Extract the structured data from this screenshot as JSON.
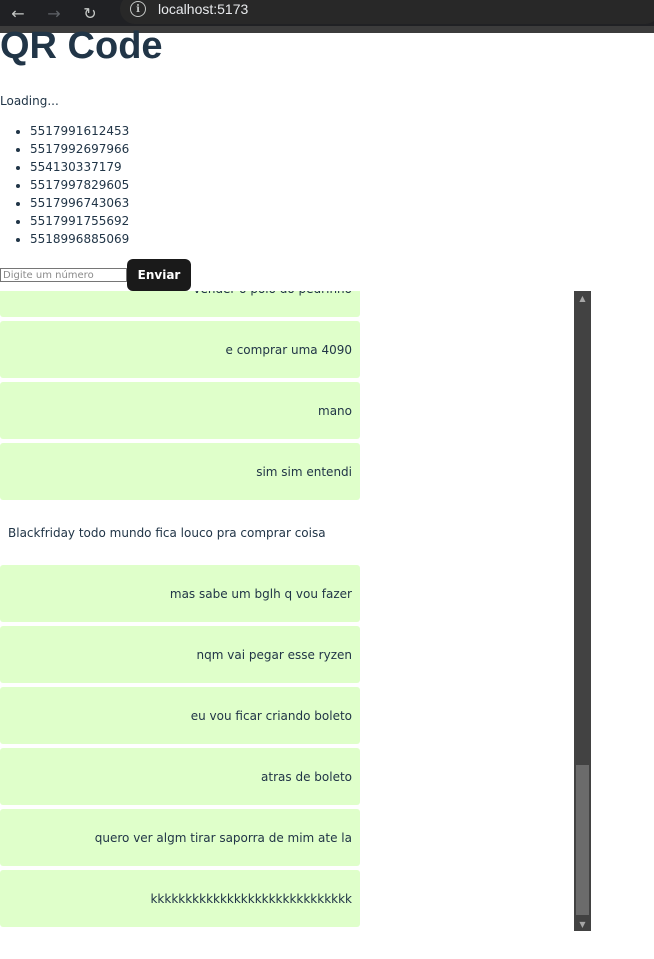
{
  "browser": {
    "url": "localhost:5173",
    "back_icon": "arrow-left-icon",
    "forward_icon": "arrow-right-icon",
    "reload_icon": "reload-icon",
    "info_icon": "info-icon"
  },
  "page": {
    "title": "QR Code",
    "status": "Loading...",
    "numbers": [
      "5517991612453",
      "5517992697966",
      "554130337179",
      "5517997829605",
      "5517996743063",
      "5517991755692",
      "5518996885069"
    ]
  },
  "form": {
    "placeholder": "Digite um número",
    "value": "",
    "send_label": "Enviar"
  },
  "chat": {
    "messages": [
      {
        "text": "vender o polo do pedrinho",
        "sent": true
      },
      {
        "text": "e comprar uma 4090",
        "sent": true
      },
      {
        "text": "mano",
        "sent": true
      },
      {
        "text": "sim sim entendi",
        "sent": true
      },
      {
        "text": "Blackfriday todo mundo fica louco pra comprar coisa",
        "sent": false
      },
      {
        "text": "mas sabe um bglh q vou fazer",
        "sent": true
      },
      {
        "text": "nqm vai pegar esse ryzen",
        "sent": true
      },
      {
        "text": "eu vou ficar criando boleto",
        "sent": true
      },
      {
        "text": "atras de boleto",
        "sent": true
      },
      {
        "text": "quero ver algm tirar saporra de mim ate la",
        "sent": true
      },
      {
        "text": "kkkkkkkkkkkkkkkkkkkkkkkkkkkkk",
        "sent": true
      }
    ]
  },
  "colors": {
    "sent_bubble": "#dfffca",
    "button_bg": "#1a1a1a",
    "browser_bg": "#202124"
  }
}
